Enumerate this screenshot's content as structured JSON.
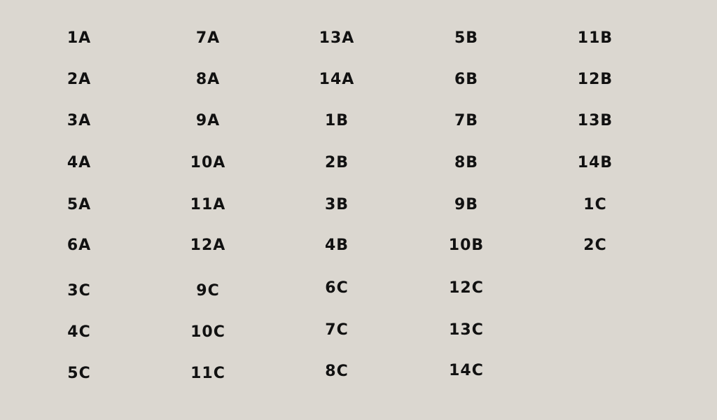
{
  "grid": {
    "columns": [
      {
        "labels": [
          "1A",
          "2A",
          "3A",
          "4A",
          "5A",
          "6A",
          "3C",
          "4C",
          "5C"
        ]
      },
      {
        "labels": [
          "7A",
          "8A",
          "9A",
          "10A",
          "11A",
          "12A",
          "9C",
          "10C",
          "11C"
        ]
      },
      {
        "labels": [
          "13A",
          "14A",
          "1B",
          "2B",
          "3B",
          "4B",
          "6C",
          "7C",
          "8C"
        ]
      },
      {
        "labels": [
          "5B",
          "6B",
          "7B",
          "8B",
          "9B",
          "10B",
          "12C",
          "13C",
          "14C"
        ]
      },
      {
        "labels": [
          "11B",
          "12B",
          "13B",
          "14B",
          "1C",
          "2C"
        ]
      }
    ]
  }
}
